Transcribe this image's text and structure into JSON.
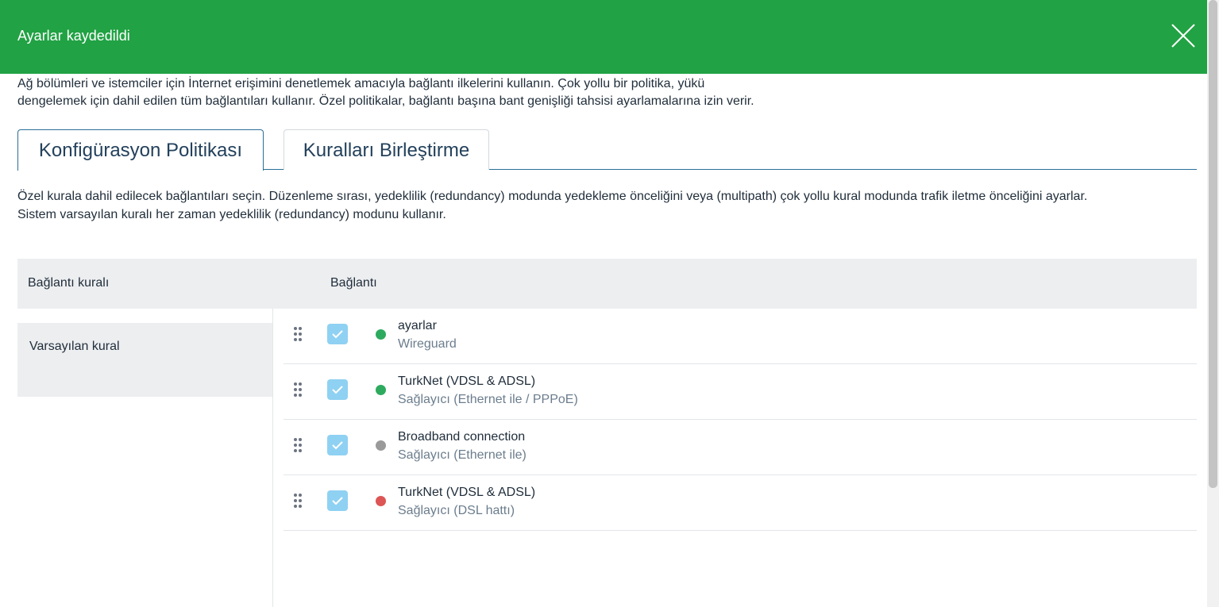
{
  "toast": {
    "message": "Ayarlar kaydedildi",
    "close_icon": "close-icon",
    "color": "#21a244"
  },
  "intro": {
    "line1": "Ağ bölümleri ve istemciler için İnternet erişimini denetlemek amacıyla bağlantı ilkelerini kullanın. Çok yollu bir politika, yükü",
    "line2": "dengelemek için dahil edilen tüm bağlantıları kullanır. Özel politikalar, bağlantı başına bant genişliği tahsisi ayarlamalarına izin verir."
  },
  "tabs": [
    {
      "label": "Konfigürasyon Politikası",
      "active": true
    },
    {
      "label": "Kuralları Birleştirme",
      "active": false
    }
  ],
  "description": {
    "line1": "Özel kurala dahil edilecek bağlantıları seçin. Düzenleme sırası, yedeklilik (redundancy) modunda yedekleme önceliğini veya (multipath) çok yollu kural modunda trafik iletme önceliğini ayarlar.",
    "line2": "Sistem varsayılan kuralı her zaman yedeklilik (redundancy) modunu kullanır."
  },
  "table": {
    "col_rule": "Bağlantı kuralı",
    "col_connection": "Bağlantı",
    "rules": [
      {
        "label": "Varsayılan kural"
      }
    ],
    "connections": [
      {
        "name": "ayarlar",
        "type": "Wireguard",
        "checked": true,
        "status_color": "#2eaa5e"
      },
      {
        "name": "TurkNet (VDSL & ADSL)",
        "type": "Sağlayıcı (Ethernet ile / PPPoE)",
        "checked": true,
        "status_color": "#2eaa5e"
      },
      {
        "name": "Broadband connection",
        "type": "Sağlayıcı (Ethernet ile)",
        "checked": true,
        "status_color": "#9a9a9a"
      },
      {
        "name": "TurkNet (VDSL & ADSL)",
        "type": "Sağlayıcı (DSL hattı)",
        "checked": true,
        "status_color": "#dd5555"
      }
    ]
  }
}
